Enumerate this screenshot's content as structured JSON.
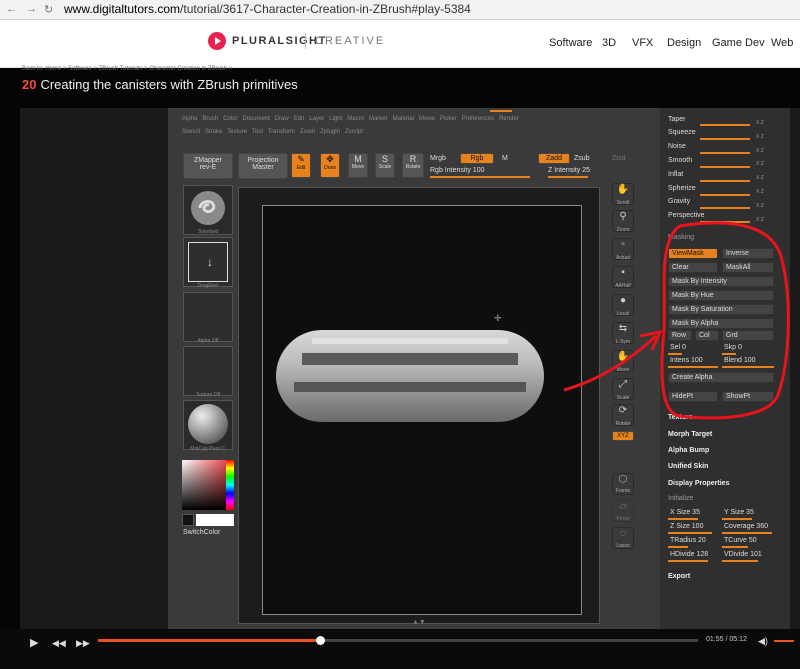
{
  "browser": {
    "url_host": "www.digitaltutors.com",
    "url_path": "/tutorial/3617-Character-Creation-in-ZBrush#play-5384"
  },
  "site": {
    "brand": "PLURALSIGHT",
    "brand_sub": "CREATIVE",
    "nav": [
      "Software",
      "3D",
      "VFX",
      "Design",
      "Game Dev",
      "Web"
    ]
  },
  "breadcrumb": "Back to: Home  >  Software  >  ZBrush Tutorials  >  Character Creation in ZBrush  >",
  "lesson": {
    "number": "20",
    "title": "Creating the canisters with ZBrush primitives"
  },
  "zbrush": {
    "menu1": [
      "Alpha",
      "Brush",
      "Color",
      "Document",
      "Draw",
      "Edit",
      "Layer",
      "Light",
      "Macro",
      "Marker",
      "Material",
      "Movie",
      "Picker",
      "Preferences",
      "Render"
    ],
    "menu2": [
      "Stencil",
      "Stroke",
      "Texture",
      "Tool",
      "Transform",
      "Zoom",
      "Zplugin",
      "Zscript"
    ],
    "zmapper": "ZMapper",
    "zmapper_ver": "rev-E",
    "projection": "Projection",
    "projection2": "Master",
    "tools": [
      "Edit",
      "Draw",
      "Move",
      "Scale",
      "Rotate"
    ],
    "mrgb": "Mrgb",
    "rgb": "Rgb",
    "m": "M",
    "rgb_intensity": "Rgb Intensity 100",
    "zadd": "Zadd",
    "zsub": "Zsub",
    "zcut": "Zcut",
    "z_intensity": "Z Intensity 25",
    "left_caps": [
      "Standard",
      "DragRect",
      "Alpha Off",
      "Texture Off",
      "MatCap Pearl C"
    ],
    "switch_color": "SwitchColor",
    "right_tools": [
      "Scroll",
      "Zoom",
      "Actual",
      "AAHalf",
      "Local",
      "L.Sym",
      "Move",
      "Scale",
      "Rotate",
      "Frame",
      "Persp",
      "Lasso"
    ],
    "xyz": "XYZ"
  },
  "palette": {
    "deform": [
      "Taper",
      "Squeeze",
      "Noise",
      "Smooth",
      "Inflat",
      "Spherize",
      "Gravity",
      "Perspective"
    ],
    "masking_title": "Masking",
    "viewmask": "ViewMask",
    "inverse": "Inverse",
    "clear": "Clear",
    "maskall": "MaskAll",
    "mask_by": [
      "Mask By Intensity",
      "Mask By Hue",
      "Mask By Saturation",
      "Mask By Alpha"
    ],
    "row": "Row",
    "col": "Col",
    "grd": "Grd",
    "sel": "Sel 0",
    "skp": "Skp 0",
    "intens": "Intens 100",
    "blend": "Blend 100",
    "create_alpha": "Create Alpha",
    "hidept": "HidePt",
    "showpt": "ShowPt",
    "sections": [
      "Texture",
      "Morph Target",
      "Alpha Bump",
      "Unified Skin",
      "Display Properties"
    ],
    "initialize": "Initialize",
    "init_sliders": [
      "X Size 35",
      "Y Size 35",
      "Z Size 100",
      "Coverage 360",
      "TRadius 20",
      "TCurve 50",
      "HDivide 128",
      "VDivide 101"
    ],
    "export": "Export"
  },
  "player": {
    "timecode": "01:55 / 05:12",
    "progress": 0.37
  },
  "colors": {
    "accent": "#e8821c",
    "annotation": "#e8141c",
    "brand": "#e8224f"
  }
}
